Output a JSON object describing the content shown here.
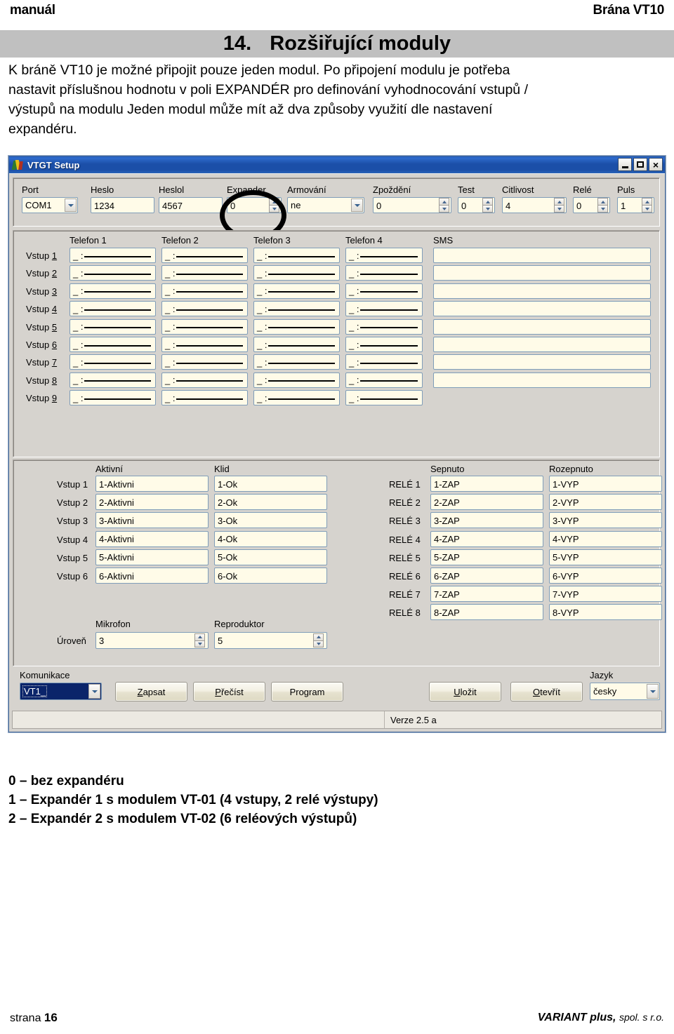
{
  "page": {
    "header_left": "manuál",
    "header_right": "Brána VT10",
    "chapter_number": "14.",
    "chapter_title": "Rozšiřující moduly",
    "intro_lines": [
      "K bráně VT10 je možné připojit pouze jeden modul. Po připojení modulu je potřeba",
      "nastavit příslušnou hodnotu v poli EXPANDÉR pro definování vyhodnocování vstupů /",
      "výstupů na modulu Jeden modul může mít až dva způsoby využití dle nastavení",
      "expandéru."
    ],
    "footer_page_label": "strana",
    "footer_page_number": "16",
    "footer_company": "VARIANT plus,",
    "footer_company_suffix": "spol. s r.o."
  },
  "notes": [
    "0 – bez expandéru",
    "1 – Expandér 1 s modulem VT-01 (4 vstupy, 2 relé výstupy)",
    "2 – Expandér 2 s modulem VT-02 (6 reléových výstupů)"
  ],
  "window": {
    "title": "VTGT Setup",
    "titlebar_buttons": {
      "minimize": "minimize-icon",
      "maximize": "maximize-icon",
      "close": "×"
    },
    "toolbar": {
      "fields": [
        {
          "label": "Port",
          "value": "COM1",
          "type": "combo"
        },
        {
          "label": "Heslo",
          "value": "1234",
          "type": "text"
        },
        {
          "label": "Heslol",
          "value": "4567",
          "type": "text"
        },
        {
          "label": "Expander",
          "value": "0",
          "type": "spinner"
        },
        {
          "label": "Armování",
          "value": "ne",
          "type": "combo"
        },
        {
          "label": "Zpoždění",
          "value": "0",
          "type": "spinner"
        },
        {
          "label": "Test",
          "value": "0",
          "type": "spinner"
        },
        {
          "label": "Citlivost",
          "value": "4",
          "type": "spinner"
        },
        {
          "label": "Relé",
          "value": "0",
          "type": "spinner"
        },
        {
          "label": "Puls",
          "value": "1",
          "type": "spinner"
        }
      ],
      "annotation": "ellipse-highlight-expander"
    },
    "phone_section": {
      "column_headers": [
        "Telefon 1",
        "Telefon 2",
        "Telefon 3",
        "Telefon 4",
        "SMS"
      ],
      "row_labels": [
        "Vstup 1",
        "Vstup 2",
        "Vstup 3",
        "Vstup 4",
        "Vstup 5",
        "Vstup 6",
        "Vstup 7",
        "Vstup 8",
        "Vstup 9"
      ],
      "phone_mask_value": "_ :",
      "sms_rows": 8,
      "sms_value": ""
    },
    "inputs_section": {
      "headers": [
        "Aktivní",
        "Klid"
      ],
      "rows": [
        {
          "label": "Vstup 1",
          "aktivni": "1-Aktivni",
          "klid": "1-Ok"
        },
        {
          "label": "Vstup 2",
          "aktivni": "2-Aktivni",
          "klid": "2-Ok"
        },
        {
          "label": "Vstup 3",
          "aktivni": "3-Aktivni",
          "klid": "3-Ok"
        },
        {
          "label": "Vstup 4",
          "aktivni": "4-Aktivni",
          "klid": "4-Ok"
        },
        {
          "label": "Vstup 5",
          "aktivni": "5-Aktivni",
          "klid": "5-Ok"
        },
        {
          "label": "Vstup 6",
          "aktivni": "6-Aktivni",
          "klid": "6-Ok"
        }
      ]
    },
    "audio_section": {
      "headers": [
        "Mikrofon",
        "Reproduktor"
      ],
      "row_label": "Úroveň",
      "mikrofon_value": "3",
      "reproduktor_value": "5"
    },
    "relay_section": {
      "headers": [
        "Sepnuto",
        "Rozepnuto"
      ],
      "rows": [
        {
          "label": "RELÉ 1",
          "sepnuto": "1-ZAP",
          "rozepnuto": "1-VYP"
        },
        {
          "label": "RELÉ 2",
          "sepnuto": "2-ZAP",
          "rozepnuto": "2-VYP"
        },
        {
          "label": "RELÉ 3",
          "sepnuto": "3-ZAP",
          "rozepnuto": "3-VYP"
        },
        {
          "label": "RELÉ 4",
          "sepnuto": "4-ZAP",
          "rozepnuto": "4-VYP"
        },
        {
          "label": "RELÉ 5",
          "sepnuto": "5-ZAP",
          "rozepnuto": "5-VYP"
        },
        {
          "label": "RELÉ 6",
          "sepnuto": "6-ZAP",
          "rozepnuto": "6-VYP"
        },
        {
          "label": "RELÉ 7",
          "sepnuto": "7-ZAP",
          "rozepnuto": "7-VYP"
        },
        {
          "label": "RELÉ 8",
          "sepnuto": "8-ZAP",
          "rozepnuto": "8-VYP"
        }
      ]
    },
    "bottom_bar": {
      "komunikace_label": "Komunikace",
      "komunikace_value": "VT1_",
      "jazyk_label": "Jazyk",
      "jazyk_value": "česky",
      "buttons": [
        {
          "name": "zapsat",
          "pre": "Z",
          "rest": "apsat"
        },
        {
          "name": "precist",
          "pre": "P",
          "rest": "řečíst"
        },
        {
          "name": "program",
          "pre": "",
          "rest": "Program"
        },
        {
          "name": "ulozit",
          "pre": "U",
          "rest": "ložit"
        },
        {
          "name": "otevrit",
          "pre": "O",
          "rest": "tevřít"
        }
      ]
    },
    "statusbar": {
      "left": "",
      "right": "Verze 2.5 a"
    }
  }
}
